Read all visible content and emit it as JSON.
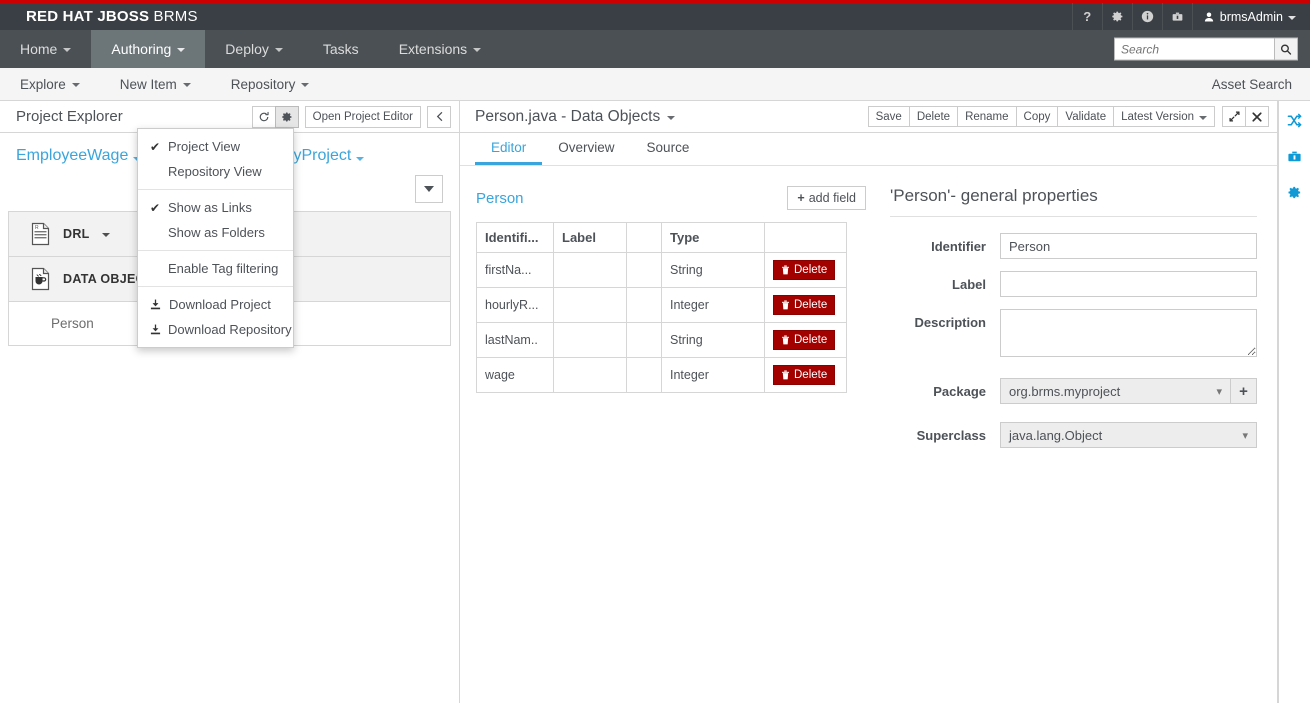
{
  "brand": {
    "bold": "RED HAT JBOSS",
    "light": "BRMS"
  },
  "masthead": {
    "icons": [
      {
        "name": "help-icon",
        "glyph": "?"
      },
      {
        "name": "gear-icon",
        "glyph": "⚙"
      },
      {
        "name": "info-icon",
        "glyph": "ⓘ"
      },
      {
        "name": "toolbox-icon",
        "glyph": "⛏"
      }
    ],
    "user": "brmsAdmin"
  },
  "nav": {
    "items": [
      {
        "label": "Home",
        "caret": true,
        "active": false
      },
      {
        "label": "Authoring",
        "caret": true,
        "active": true
      },
      {
        "label": "Deploy",
        "caret": true,
        "active": false
      },
      {
        "label": "Tasks",
        "caret": false,
        "active": false
      },
      {
        "label": "Extensions",
        "caret": true,
        "active": false
      }
    ],
    "search_placeholder": "Search",
    "search_value": ""
  },
  "subnav": {
    "items": [
      {
        "label": "Explore",
        "caret": true
      },
      {
        "label": "New Item",
        "caret": true
      },
      {
        "label": "Repository",
        "caret": true
      }
    ],
    "right_label": "Asset Search"
  },
  "explorer": {
    "title": "Project Explorer",
    "refresh_label": "↻",
    "gear_label": "⚙",
    "open_project_editor": "Open Project Editor",
    "collapse_label": "‹",
    "breadcrumb": [
      {
        "label": "EmployeeWage",
        "caret": true
      },
      {
        "label": "",
        "caret": true
      },
      {
        "label": "MyProject",
        "caret": true
      }
    ],
    "breadcrumb_separator": "»",
    "groups": [
      {
        "label": "DRL",
        "icon": "drl-file-icon",
        "caret": true,
        "items": []
      },
      {
        "label": "DATA OBJECTS",
        "icon": "java-file-icon",
        "caret": false,
        "items": [
          "Person"
        ]
      }
    ]
  },
  "gear_menu": {
    "items": [
      {
        "label": "Project View",
        "checked": true,
        "icon": ""
      },
      {
        "label": "Repository View",
        "checked": false,
        "icon": ""
      },
      {
        "sep": true
      },
      {
        "label": "Show as Links",
        "checked": true,
        "icon": ""
      },
      {
        "label": "Show as Folders",
        "checked": false,
        "icon": ""
      },
      {
        "sep": true
      },
      {
        "label": "Enable Tag filtering",
        "checked": false,
        "icon": ""
      },
      {
        "sep": true
      },
      {
        "label": "Download Project",
        "checked": false,
        "icon": "download-icon"
      },
      {
        "label": "Download Repository",
        "checked": false,
        "icon": "download-icon"
      }
    ]
  },
  "editor": {
    "title": "Person.java - Data Objects",
    "actions": [
      {
        "label": "Save",
        "name": "save-button"
      },
      {
        "label": "Delete",
        "name": "delete-button"
      },
      {
        "label": "Rename",
        "name": "rename-button"
      },
      {
        "label": "Copy",
        "name": "copy-button"
      },
      {
        "label": "Validate",
        "name": "validate-button"
      },
      {
        "label": "Latest Version",
        "name": "version-dropdown",
        "caret": true
      }
    ],
    "maximize_label": "⤡",
    "close_label": "✖",
    "tabs": [
      {
        "label": "Editor",
        "active": true
      },
      {
        "label": "Overview",
        "active": false
      },
      {
        "label": "Source",
        "active": false
      }
    ],
    "object_name": "Person",
    "add_field_label": "add field",
    "add_field_icon": "+",
    "table": {
      "columns": [
        "Identifi...",
        "Label",
        "",
        "Type",
        ""
      ],
      "delete_label": "Delete",
      "delete_icon": "🗑",
      "rows": [
        {
          "identifier": "firstNa...",
          "label": "",
          "extra": "",
          "type": "String"
        },
        {
          "identifier": "hourlyR...",
          "label": "",
          "extra": "",
          "type": "Integer"
        },
        {
          "identifier": "lastNam..",
          "label": "",
          "extra": "",
          "type": "String"
        },
        {
          "identifier": "wage",
          "label": "",
          "extra": "",
          "type": "Integer"
        }
      ]
    },
    "properties": {
      "title": "'Person'- general properties",
      "identifier_label": "Identifier",
      "identifier_value": "Person",
      "label_label": "Label",
      "label_value": "",
      "description_label": "Description",
      "description_value": "",
      "package_label": "Package",
      "package_value": "org.brms.myproject",
      "package_add_label": "+",
      "superclass_label": "Superclass",
      "superclass_value": "java.lang.Object"
    }
  },
  "rail": {
    "icons": [
      {
        "name": "shuffle-icon"
      },
      {
        "name": "toolbox-icon"
      },
      {
        "name": "gear-icon"
      }
    ]
  },
  "colors": {
    "brand_red": "#cc0000",
    "masthead": "#393f44",
    "navbar": "#4a5053",
    "accent_blue": "#39a5dc",
    "danger_red": "#a30000"
  }
}
